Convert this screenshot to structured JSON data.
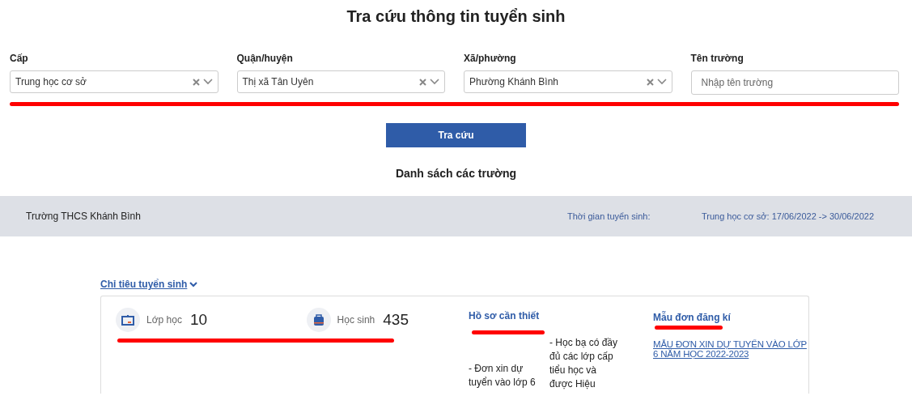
{
  "title": "Tra cứu thông tin tuyển sinh",
  "filters": {
    "underlined": true,
    "fields": [
      {
        "label": "Cấp",
        "kind": "select",
        "value": "Trung học cơ sở"
      },
      {
        "label": "Quận/huyện",
        "kind": "select",
        "value": "Thị xã Tân Uyên"
      },
      {
        "label": "Xã/phường",
        "kind": "select",
        "value": "Phường Khánh Bình"
      },
      {
        "label": "Tên trường",
        "kind": "text",
        "placeholder": "Nhập tên trường"
      }
    ]
  },
  "search_button": "Tra cứu",
  "list_title": "Danh sách các trường",
  "school": {
    "name": "Trường THCS Khánh Bình",
    "period_label": "Thời gian tuyển sinh:",
    "period": "Trung học cơ sở: 17/06/2022 -> 30/06/2022",
    "quota_link": "Chỉ tiêu tuyển sinh",
    "expanded": true,
    "stats": {
      "underlined": true,
      "items": [
        {
          "kind": "class",
          "label": "Lớp học",
          "value": "10"
        },
        {
          "kind": "student",
          "label": "Học sinh",
          "value": "435"
        }
      ]
    },
    "documents": {
      "title": "Hồ sơ cần thiết",
      "underlined": true,
      "items": [
        "- Đơn xin dự tuyển vào lớp 6",
        "- Học bạ có đầy đủ các lớp cấp tiểu học và được Hiệu"
      ]
    },
    "forms": {
      "title": "Mẫu đơn đăng kí",
      "underlined": true,
      "links": [
        "MẪU ĐƠN XIN DỰ TUYỂN VÀO LỚP 6 NĂM HỌC 2022-2023"
      ]
    }
  }
}
